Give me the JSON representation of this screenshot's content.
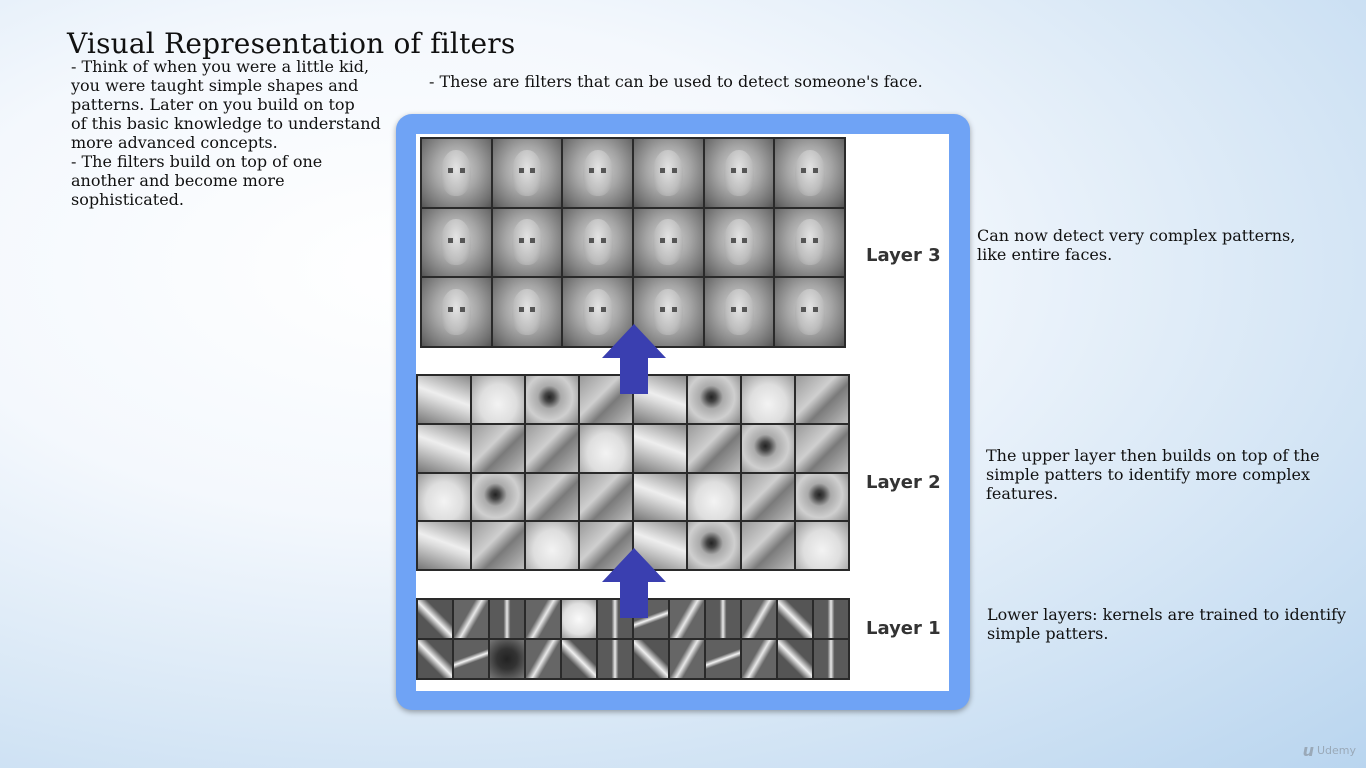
{
  "slide": {
    "title": "Visual Representation of filters",
    "left_bullets": [
      "- Think of when you were a little kid,\nyou were taught simple shapes and\npatterns. Later on you build on top\nof this basic knowledge to understand\nmore advanced concepts.",
      "- The filters build on top of one\nanother and become more\nsophisticated."
    ],
    "top_caption": "- These are filters that can be used to detect someone's face.",
    "captions": {
      "layer3": "Can now detect very complex patterns,\nlike entire faces.",
      "layer2": "The upper layer then builds on top of the\nsimple patters to identify more complex\nfeatures.",
      "layer1": "Lower layers: kernels are trained to identify\nsimple patters."
    }
  },
  "figure": {
    "layer_labels": {
      "layer3": "Layer 3",
      "layer2": "Layer 2",
      "layer1": "Layer 1"
    },
    "frame_color": "#6fa3f5",
    "arrow_color": "#3a3fb0",
    "layer3_grid": {
      "rows": 3,
      "cols": 6,
      "content": "face-filters"
    },
    "layer2_grid": {
      "rows": 4,
      "cols": 8,
      "content": "facial-part-filters"
    },
    "layer1_grid": {
      "rows": 2,
      "cols": 12,
      "content": "edge-kernels"
    }
  },
  "watermark": {
    "logo_icon": "udemy-logo-icon",
    "text": "Udemy"
  }
}
